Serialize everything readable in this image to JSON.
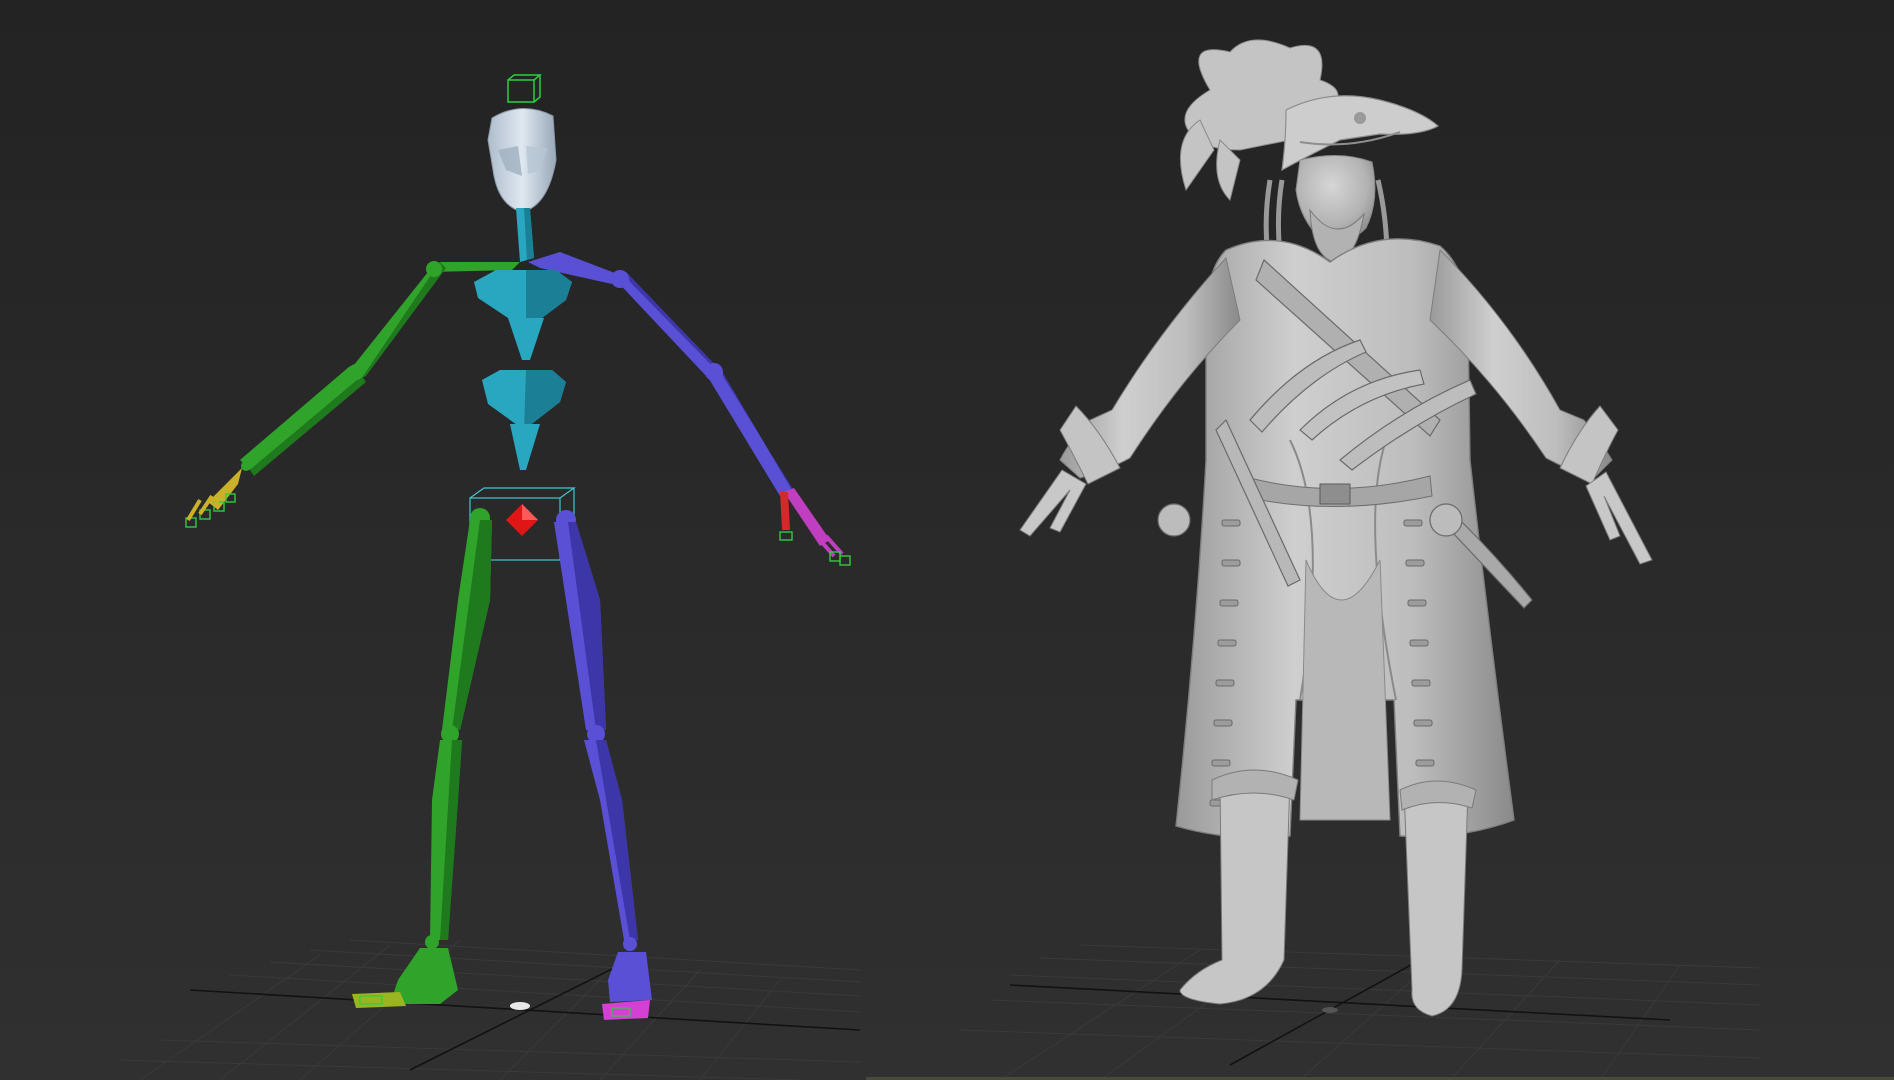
{
  "app": {
    "name": "3D viewport",
    "viewports": [
      {
        "id": "left",
        "content": "character-rig-skeleton"
      },
      {
        "id": "right",
        "content": "pirate-character-sculpt"
      }
    ]
  },
  "colors": {
    "background_top": "#242424",
    "background_bottom": "#2f2f2f",
    "grid_line": "#3c3c3c",
    "grid_axis": "#151515",
    "bone_left": "#2fa32a",
    "bone_left_shade": "#1e7a1c",
    "bone_right": "#5a50d6",
    "bone_right_shade": "#3d36a8",
    "spine": "#2aa7c0",
    "spine_shade": "#1b7f95",
    "head": "#c9d6e2",
    "root_marker": "#e01515",
    "selection_box": "#3fc7d0",
    "gizmo_green": "#2ecc40",
    "foot_left": "#9bb520",
    "foot_right": "#d43fd4",
    "hand_left": "#c9b22a",
    "hand_right": "#c03fc0",
    "sculpt": "#c9c9c9",
    "sculpt_shade": "#8c8c8c",
    "sculpt_dark": "#5e5e5e"
  }
}
